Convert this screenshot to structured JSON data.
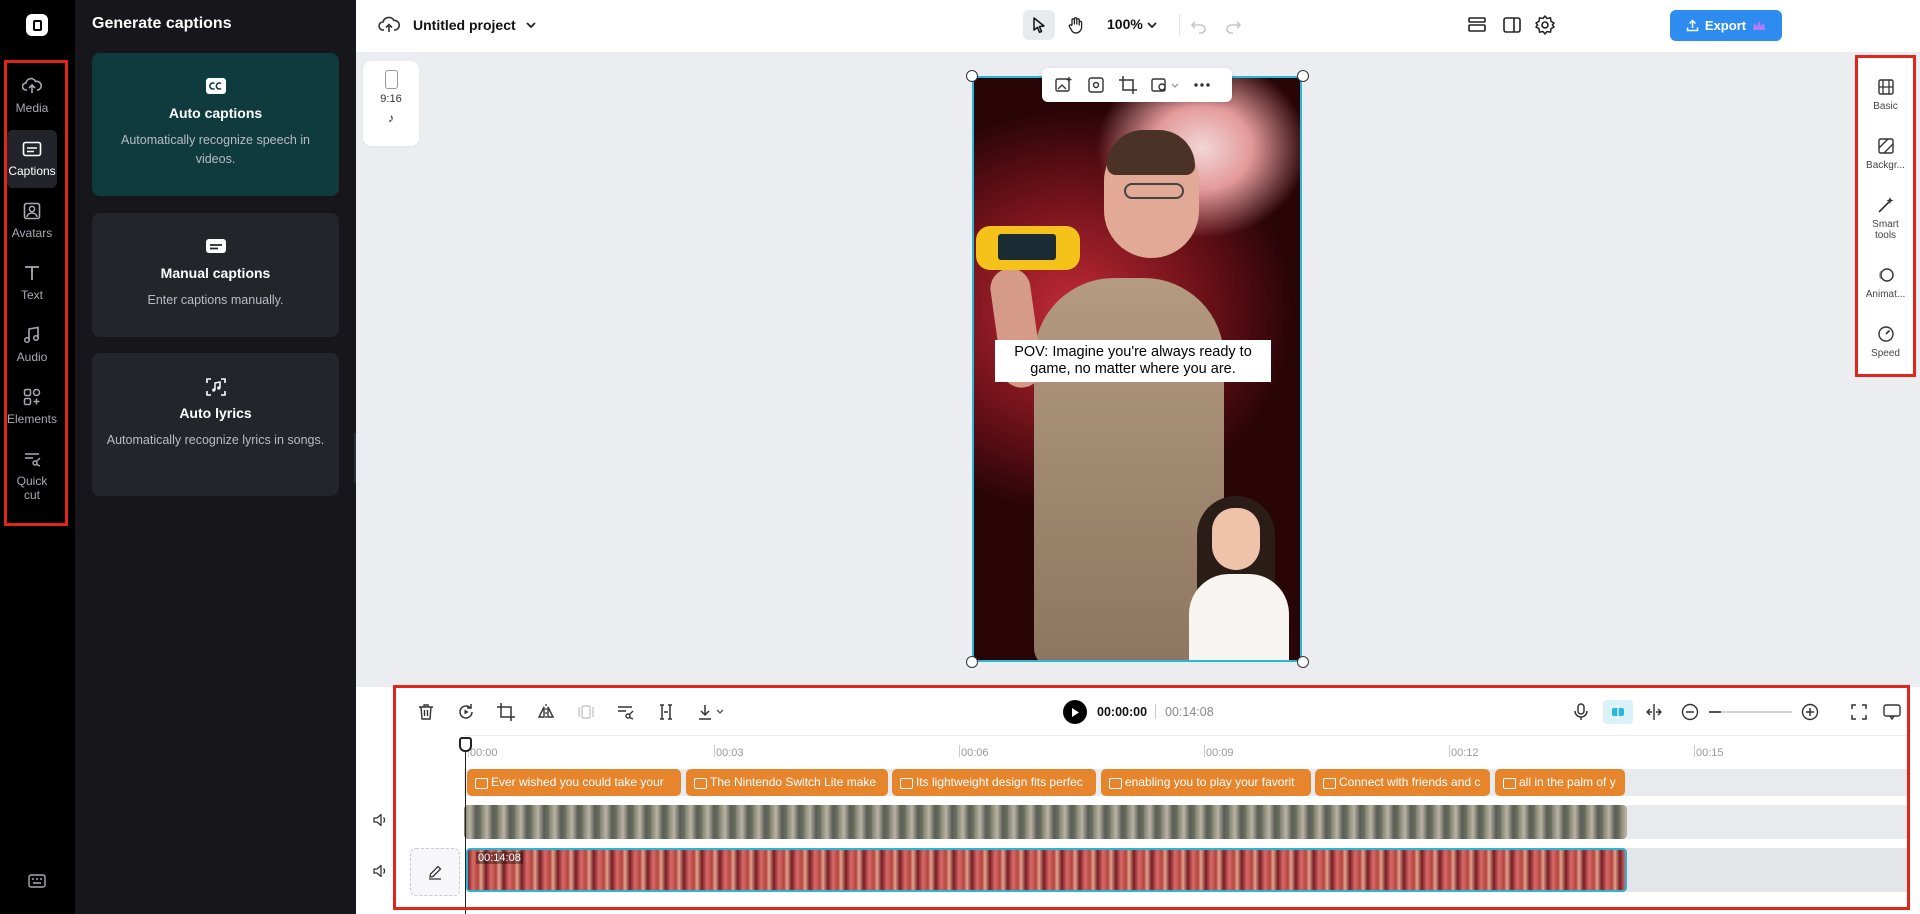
{
  "rail": {
    "items": [
      {
        "label": "Media",
        "icon": "cloud-upload-icon"
      },
      {
        "label": "Captions",
        "icon": "captions-icon",
        "active": true
      },
      {
        "label": "Avatars",
        "icon": "avatar-icon"
      },
      {
        "label": "Text",
        "icon": "text-icon"
      },
      {
        "label": "Audio",
        "icon": "music-note-icon"
      },
      {
        "label": "Elements",
        "icon": "elements-icon"
      },
      {
        "label": "Quick cut",
        "icon": "quick-cut-icon"
      }
    ]
  },
  "panel": {
    "title": "Generate captions",
    "cards": [
      {
        "title": "Auto captions",
        "desc": "Automatically recognize speech in videos.",
        "icon": "cc-icon"
      },
      {
        "title": "Manual captions",
        "desc": "Enter captions manually.",
        "icon": "subtitle-icon"
      },
      {
        "title": "Auto lyrics",
        "desc": "Automatically recognize lyrics in songs.",
        "icon": "lyrics-icon"
      }
    ]
  },
  "topbar": {
    "project": "Untitled project",
    "zoom": "100%",
    "export_label": "Export"
  },
  "canvas": {
    "ratio_label": "9:16",
    "caption_text": "POV: Imagine you're always ready to game, no matter where you are."
  },
  "right_rail": {
    "items": [
      {
        "label": "Basic",
        "icon": "film-icon"
      },
      {
        "label": "Backgr...",
        "icon": "background-icon"
      },
      {
        "label": "Smart tools",
        "icon": "magic-wand-icon"
      },
      {
        "label": "Animat...",
        "icon": "animation-icon"
      },
      {
        "label": "Speed",
        "icon": "speed-icon"
      }
    ]
  },
  "timeline": {
    "current_time": "00:00:00",
    "total_time": "00:14:08",
    "ruler": [
      "00:00",
      "00:03",
      "00:06",
      "00:09",
      "00:12",
      "00:15"
    ],
    "caption_clips": [
      "Ever wished you could take your",
      "The Nintendo Switch Lite make",
      "Its lightweight design fits perfec",
      "enabling you to play your favorit",
      "Connect with friends and c",
      "all in the palm of y"
    ],
    "clip_duration": "00:14:08"
  },
  "colors": {
    "accent": "#2e8bf0",
    "caption_clip": "#e7852c",
    "selection": "#29b6d7",
    "highlight_box": "#e1251b"
  }
}
